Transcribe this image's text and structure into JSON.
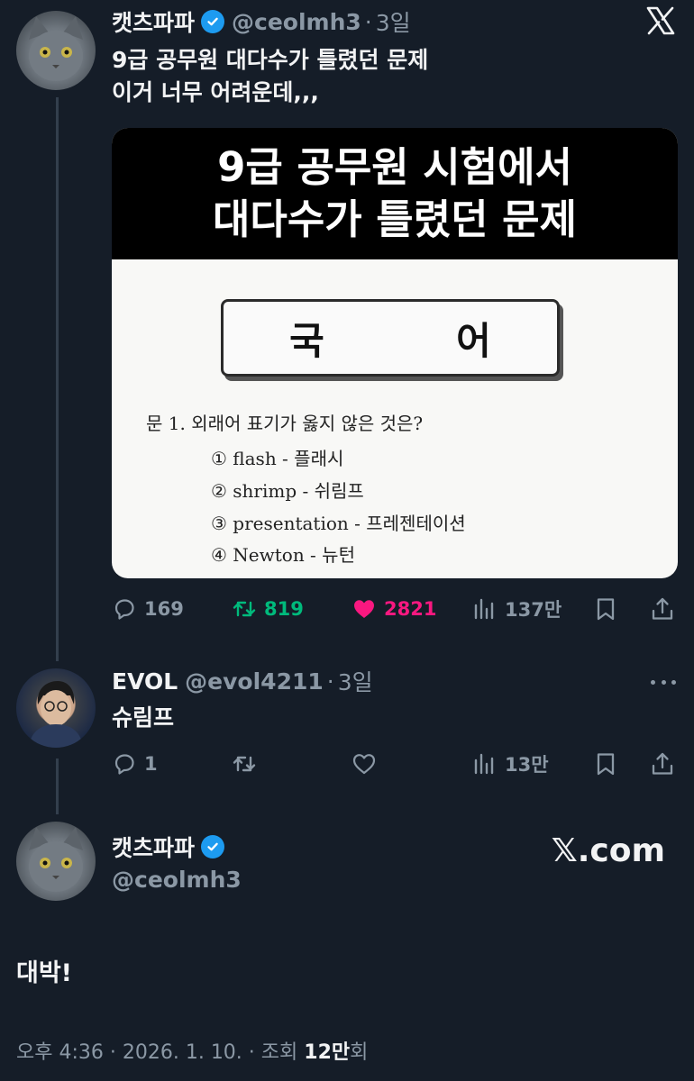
{
  "main_tweet": {
    "display_name": "캣츠파파",
    "handle": "@ceolmh3",
    "separator": "·",
    "time": "3일",
    "text_line1": "9급 공무원 대다수가 틀렸던 문제",
    "text_line2": "이거 너무 어려운데,,,",
    "media": {
      "title_line1": "9급 공무원 시험에서",
      "title_line2": "대다수가 틀렸던 문제",
      "subject_char1": "국",
      "subject_char2": "어",
      "question": "문  1. 외래어 표기가 옳지 않은 것은?",
      "options": [
        "① flash - 플래시",
        "② shrimp - 쉬림프",
        "③ presentation - 프레젠테이션",
        "④ Newton - 뉴턴"
      ]
    },
    "stats": {
      "replies": "169",
      "reposts": "819",
      "likes": "2821",
      "views": "137만"
    }
  },
  "reply": {
    "display_name": "EVOL",
    "handle": "@evol4211",
    "separator": "·",
    "time": "3일",
    "text": "슈림프",
    "stats": {
      "replies": "1",
      "views": "13만"
    }
  },
  "focused_tweet": {
    "display_name": "캣츠파파",
    "handle": "@ceolmh3",
    "watermark": "𝕏.com",
    "text": "대박!",
    "footer_prefix": "오후 4:36 · 2026. 1. 10. · 조회 ",
    "footer_count": "12만",
    "footer_suffix": "회"
  },
  "colors": {
    "background": "#151d28",
    "verified": "#1d9bf0",
    "repost_active": "#00ba7c",
    "like_active": "#f91880",
    "muted": "#8b98a5"
  }
}
